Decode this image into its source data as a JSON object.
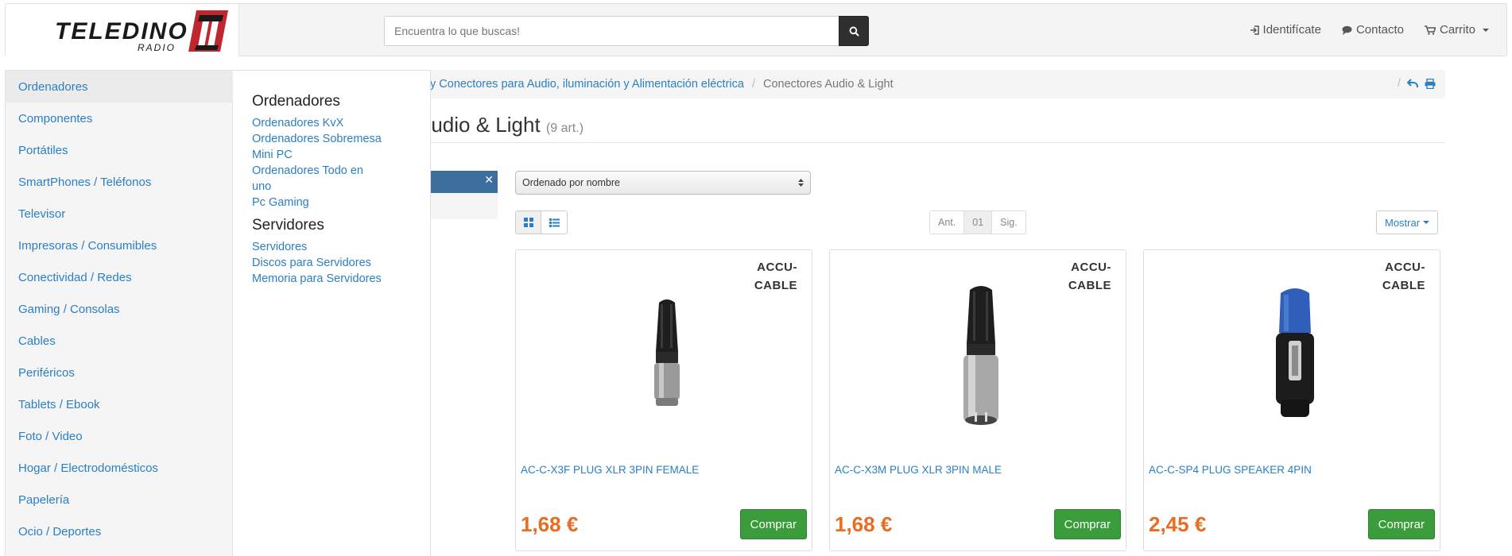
{
  "header": {
    "logo_text": "TELEDINO",
    "logo_sub": "RADIO",
    "search_placeholder": "Encuentra lo que buscas!",
    "links": [
      {
        "icon": "sign-in-icon",
        "label": "Identifícate"
      },
      {
        "icon": "comment-icon",
        "label": "Contacto"
      },
      {
        "icon": "cart-icon",
        "label": "Carrito"
      }
    ]
  },
  "breadcrumb": {
    "items": [
      {
        "label": "y Conectores para Audio, iluminación y Alimentación eléctrica"
      },
      {
        "label": "Conectores Audio & Light"
      }
    ]
  },
  "page": {
    "title": "Audio & Light",
    "count": "(9 art.)"
  },
  "controls": {
    "sort_value": "Ordenado por nombre",
    "pager": {
      "prev": "Ant.",
      "current": "01",
      "next": "Sig."
    },
    "show_label": "Mostrar"
  },
  "products": [
    {
      "brand_line1": "ACCU-",
      "brand_line2": "CABLE",
      "name": "AC-C-X3F PLUG XLR 3PIN FEMALE",
      "price": "1,68 €",
      "buy_label": "Comprar"
    },
    {
      "brand_line1": "ACCU-",
      "brand_line2": "CABLE",
      "name": "AC-C-X3M PLUG XLR 3PIN MALE",
      "price": "1,68 €",
      "buy_label": "Comprar"
    },
    {
      "brand_line1": "ACCU-",
      "brand_line2": "CABLE",
      "name": "AC-C-SP4 PLUG SPEAKER 4PIN",
      "price": "2,45 €",
      "buy_label": "Comprar"
    }
  ],
  "menu": {
    "categories": [
      "Ordenadores",
      "Componentes",
      "Portátiles",
      "SmartPhones / Teléfonos",
      "Televisor",
      "Impresoras / Consumibles",
      "Conectividad / Redes",
      "Gaming / Consolas",
      "Cables",
      "Periféricos",
      "Tablets / Ebook",
      "Foto / Video",
      "Hogar / Electrodomésticos",
      "Papelería",
      "Ocio / Deportes"
    ],
    "groups": [
      {
        "heading": "Ordenadores",
        "links": [
          "Ordenadores KvX",
          "Ordenadores Sobremesa",
          "Mini PC",
          "Ordenadores Todo en uno",
          "Pc Gaming"
        ]
      },
      {
        "heading": "Servidores",
        "links": [
          "Servidores",
          "Discos para Servidores",
          "Memoria para Servidores"
        ]
      }
    ]
  }
}
